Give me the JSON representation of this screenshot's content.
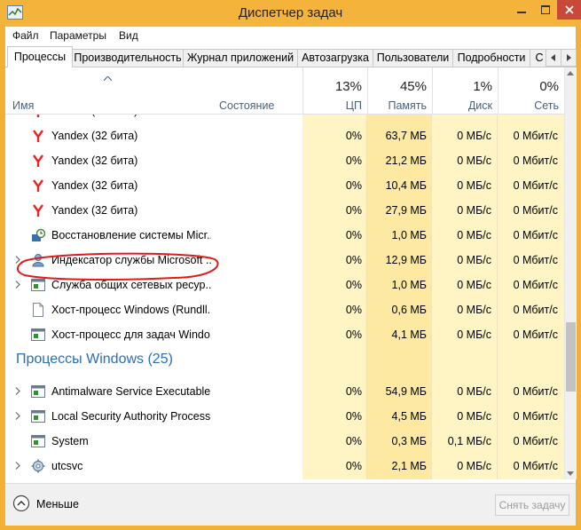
{
  "window": {
    "title": "Диспетчер задач"
  },
  "menu": [
    "Файл",
    "Параметры",
    "Вид"
  ],
  "tabs": [
    "Процессы",
    "Производительность",
    "Журнал приложений",
    "Автозагрузка",
    "Пользователи",
    "Подробности",
    "С"
  ],
  "columns": {
    "name": "Имя",
    "state": "Состояние",
    "cpu": {
      "pct": "13%",
      "label": "ЦП"
    },
    "mem": {
      "pct": "45%",
      "label": "Память"
    },
    "disk": {
      "pct": "1%",
      "label": "Диск"
    },
    "net": {
      "pct": "0%",
      "label": "Сеть"
    }
  },
  "colors": {
    "heat_light": "#fff4c4",
    "heat_mid": "#fde9a2",
    "accent_blue": "#2a6db8",
    "title_bar": "#f4b43c"
  },
  "rows": [
    {
      "name": "Yandex (32 бита)",
      "icon": "yandex-icon",
      "expand": false,
      "cpu": "0%",
      "mem": "63,7 МБ",
      "disk": "0 МБ/с",
      "net": "0 Мбит/с"
    },
    {
      "name": "Yandex (32 бита)",
      "icon": "yandex-icon",
      "expand": false,
      "cpu": "0%",
      "mem": "21,2 МБ",
      "disk": "0 МБ/с",
      "net": "0 Мбит/с"
    },
    {
      "name": "Yandex (32 бита)",
      "icon": "yandex-icon",
      "expand": false,
      "cpu": "0%",
      "mem": "10,4 МБ",
      "disk": "0 МБ/с",
      "net": "0 Мбит/с"
    },
    {
      "name": "Yandex (32 бита)",
      "icon": "yandex-icon",
      "expand": false,
      "cpu": "0%",
      "mem": "27,9 МБ",
      "disk": "0 МБ/с",
      "net": "0 Мбит/с"
    },
    {
      "name": "Восстановление системы Micr...",
      "icon": "system-restore-icon",
      "expand": false,
      "cpu": "0%",
      "mem": "1,0 МБ",
      "disk": "0 МБ/с",
      "net": "0 Мбит/с"
    },
    {
      "name": "Индексатор службы Microsoft ...",
      "icon": "indexer-icon",
      "expand": true,
      "cpu": "0%",
      "mem": "12,9 МБ",
      "disk": "0 МБ/с",
      "net": "0 Мбит/с"
    },
    {
      "name": "Служба общих сетевых ресур...",
      "icon": "service-window-icon",
      "expand": true,
      "cpu": "0%",
      "mem": "1,0 МБ",
      "disk": "0 МБ/с",
      "net": "0 Мбит/с"
    },
    {
      "name": "Хост-процесс Windows (Rundll...",
      "icon": "document-icon",
      "expand": false,
      "cpu": "0%",
      "mem": "0,6 МБ",
      "disk": "0 МБ/с",
      "net": "0 Мбит/с"
    },
    {
      "name": "Хост-процесс для задач Windo...",
      "icon": "service-window-icon",
      "expand": false,
      "cpu": "0%",
      "mem": "4,1 МБ",
      "disk": "0 МБ/с",
      "net": "0 Мбит/с"
    }
  ],
  "section": {
    "title": "Процессы Windows (25)"
  },
  "win_rows": [
    {
      "name": "Antimalware Service Executable",
      "icon": "service-window-icon",
      "expand": true,
      "cpu": "0%",
      "mem": "54,9 МБ",
      "disk": "0 МБ/с",
      "net": "0 Мбит/с"
    },
    {
      "name": "Local Security Authority Process...",
      "icon": "service-window-icon",
      "expand": true,
      "cpu": "0%",
      "mem": "4,5 МБ",
      "disk": "0 МБ/с",
      "net": "0 Мбит/с"
    },
    {
      "name": "System",
      "icon": "service-window-icon",
      "expand": false,
      "cpu": "0%",
      "mem": "0,3 МБ",
      "disk": "0,1 МБ/с",
      "net": "0 Мбит/с"
    },
    {
      "name": "utcsvc",
      "icon": "gear-icon",
      "expand": true,
      "cpu": "0%",
      "mem": "2,1 МБ",
      "disk": "0 МБ/с",
      "net": "0 Мбит/с"
    }
  ],
  "footer": {
    "less_label": "Меньше",
    "end_task_label": "Снять задачу"
  }
}
